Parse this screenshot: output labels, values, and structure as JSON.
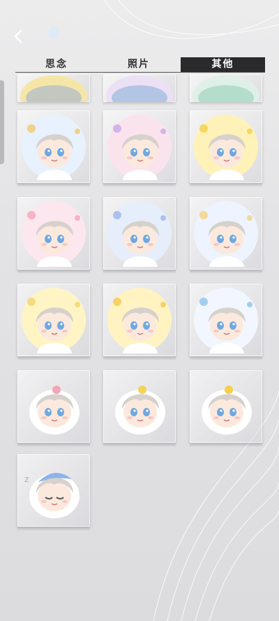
{
  "tabs": [
    {
      "label": "思念",
      "selected": false
    },
    {
      "label": "照片",
      "selected": false
    },
    {
      "label": "其他",
      "selected": true
    }
  ],
  "badges": [
    {
      "art": "badge-top-partial",
      "bg": "#f5e6a8",
      "accent": "#8fa7d8"
    },
    {
      "art": "badge-top-partial",
      "bg": "#ece0f5",
      "accent": "#7aa9d6"
    },
    {
      "art": "badge-top-partial",
      "bg": "#dff0e8",
      "accent": "#8cc9b0"
    },
    {
      "art": "badge-space",
      "bg": "#e8f2ff",
      "accent": "#f1c86b"
    },
    {
      "art": "badge-pink-stripes",
      "bg": "#fbe3ee",
      "accent": "#c8a8e8"
    },
    {
      "art": "badge-star-costume",
      "bg": "#fff2b8",
      "accent": "#f3cf4a"
    },
    {
      "art": "badge-pink-flowers",
      "bg": "#fde7ee",
      "accent": "#f4a6b8"
    },
    {
      "art": "badge-blue-tie",
      "bg": "#e6eefc",
      "accent": "#9fb4e8"
    },
    {
      "art": "badge-plaid-yellow",
      "bg": "#eef4ff",
      "accent": "#f2d27b"
    },
    {
      "art": "badge-raincoat",
      "bg": "#fff5c4",
      "accent": "#f3d56a"
    },
    {
      "art": "badge-bunny-yellow",
      "bg": "#fff3c2",
      "accent": "#f3c94f"
    },
    {
      "art": "badge-blue-flowers",
      "bg": "#f2f7ff",
      "accent": "#8ec4ea"
    },
    {
      "art": "sticker-flower-head",
      "bg": "none",
      "accent": "#f3a6b6"
    },
    {
      "art": "sticker-sparkle-head",
      "bg": "none",
      "accent": "#f3d35a"
    },
    {
      "art": "sticker-chick-head",
      "bg": "none",
      "accent": "#f3cf4a"
    },
    {
      "art": "sticker-sleepy-head",
      "bg": "none",
      "accent": "#8fb3e8"
    }
  ]
}
